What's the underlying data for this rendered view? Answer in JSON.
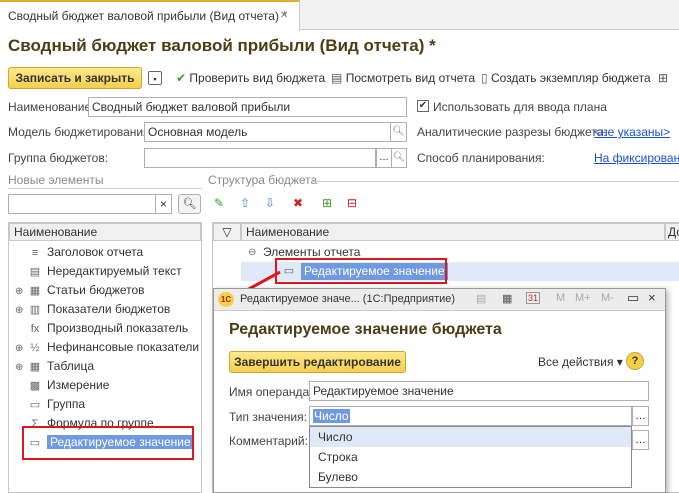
{
  "tab": {
    "label": "Сводный бюджет валовой прибыли (Вид отчета) *"
  },
  "title": "Сводный бюджет валовой прибыли (Вид отчета) *",
  "toolbar": {
    "save_close": "Записать и закрыть",
    "check": "Проверить вид бюджета",
    "view": "Посмотреть вид отчета",
    "create": "Создать экземпляр бюджета"
  },
  "form": {
    "name_label": "Наименование:",
    "name_value": "Сводный бюджет валовой прибыли",
    "use_plan_label": "Использовать для ввода плана",
    "model_label": "Модель бюджетирования:",
    "model_value": "Основная модель",
    "analytics_label": "Аналитические разрезы бюджета:",
    "analytics_link": "<не указаны>",
    "group_label": "Группа бюджетов:",
    "group_value": "",
    "planning_label": "Способ планирования:",
    "planning_link": "На фиксированны"
  },
  "new_elements": {
    "section": "Новые элементы",
    "header": "Наименование",
    "items": [
      {
        "label": "Заголовок отчета",
        "icon": "≡"
      },
      {
        "label": "Нередактируемый текст",
        "icon": "▤"
      },
      {
        "label": "Статьи бюджетов",
        "icon": "▦"
      },
      {
        "label": "Показатели бюджетов",
        "icon": "▥"
      },
      {
        "label": "Производный показатель",
        "icon": "fx"
      },
      {
        "label": "Нефинансовые показатели",
        "icon": "½"
      },
      {
        "label": "Таблица",
        "icon": "▦"
      },
      {
        "label": "Измерение",
        "icon": "▩"
      },
      {
        "label": "Группа",
        "icon": "▭"
      },
      {
        "label": "Формула по группе",
        "icon": "Σ"
      },
      {
        "label": "Редактируемое значение",
        "icon": "▭"
      }
    ]
  },
  "structure": {
    "section": "Структура бюджета",
    "header": "Наименование",
    "header2": "До",
    "root": "Элементы отчета",
    "child": "Редактируемое значение"
  },
  "modal": {
    "window_title": "Редактируемое значе... (1С:Предприятие)",
    "heading": "Редактируемое значение бюджета",
    "finish_btn": "Завершить редактирование",
    "all_actions": "Все действия",
    "operand_label": "Имя операнда:",
    "operand_value": "Редактируемое значение",
    "type_label": "Тип значения:",
    "type_value": "Число",
    "comment_label": "Комментарий:",
    "options": [
      "Число",
      "Строка",
      "Булево"
    ]
  },
  "colors": {
    "accent": "#f5cf4a",
    "title": "#4d3d14",
    "link": "#1a4fd4",
    "highlight": "#e0161e",
    "selection": "#6f9ae0"
  }
}
